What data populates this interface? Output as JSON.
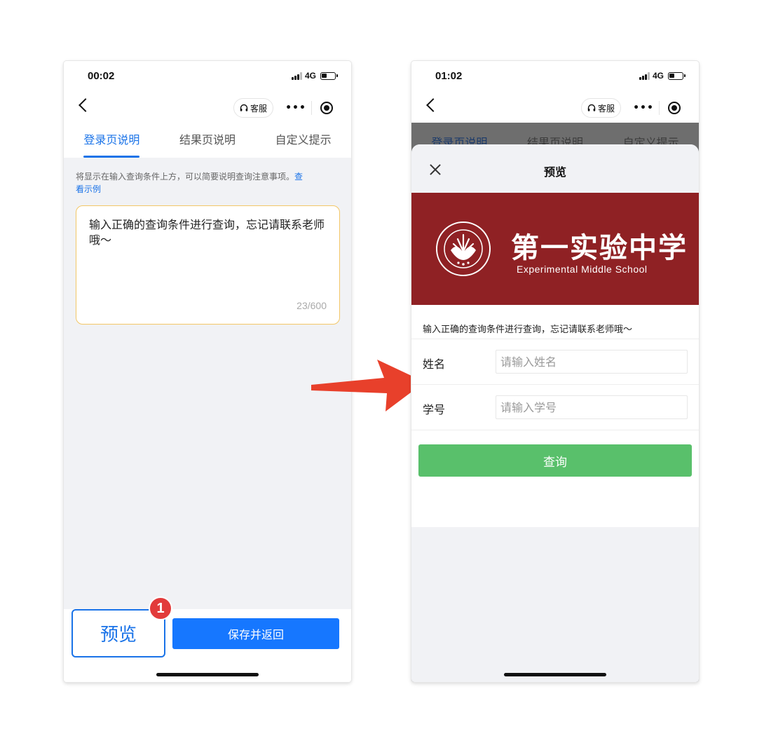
{
  "left_phone": {
    "status": {
      "time": "00:02",
      "network": "4G"
    },
    "nav": {
      "service_label": "客服",
      "menu_label": "•••"
    },
    "tabs": [
      {
        "label": "登录页说明",
        "active": true
      },
      {
        "label": "结果页说明",
        "active": false
      },
      {
        "label": "自定义提示",
        "active": false
      }
    ],
    "hint": {
      "text": "将显示在输入查询条件上方，可以简要说明查询注意事项。",
      "link": "查看示例"
    },
    "editor": {
      "text": "输入正确的查询条件进行查询，忘记请联系老师哦～",
      "count": "23/600"
    },
    "bottom": {
      "preview_label": "预览",
      "badge": "1",
      "save_label": "保存并返回"
    }
  },
  "right_phone": {
    "status": {
      "time": "01:02",
      "network": "4G"
    },
    "nav": {
      "service_label": "客服",
      "menu_label": "•••"
    },
    "tabs": [
      {
        "label": "登录页说明",
        "active": true
      },
      {
        "label": "结果页说明",
        "active": false
      },
      {
        "label": "自定义提示",
        "active": false
      }
    ],
    "sheet": {
      "title": "预览",
      "banner": {
        "school_cn": "第一实验中学",
        "school_en": "Experimental Middle School",
        "seal_text": "第一实验中学 Experimental Middle School"
      },
      "notice": "输入正确的查询条件进行查询，忘记请联系老师哦～",
      "fields": [
        {
          "label": "姓名",
          "placeholder": "请输入姓名"
        },
        {
          "label": "学号",
          "placeholder": "请输入学号"
        }
      ],
      "query_label": "查询"
    }
  },
  "colors": {
    "accent_blue": "#1a73e8",
    "save_blue": "#1677ff",
    "badge_red": "#e23b3b",
    "banner_red": "#8f2124",
    "query_green": "#59c06b",
    "arrow_red": "#e8402b"
  },
  "icons": [
    "back-icon",
    "headset-icon",
    "target-icon",
    "close-icon",
    "arrow-right-icon"
  ]
}
